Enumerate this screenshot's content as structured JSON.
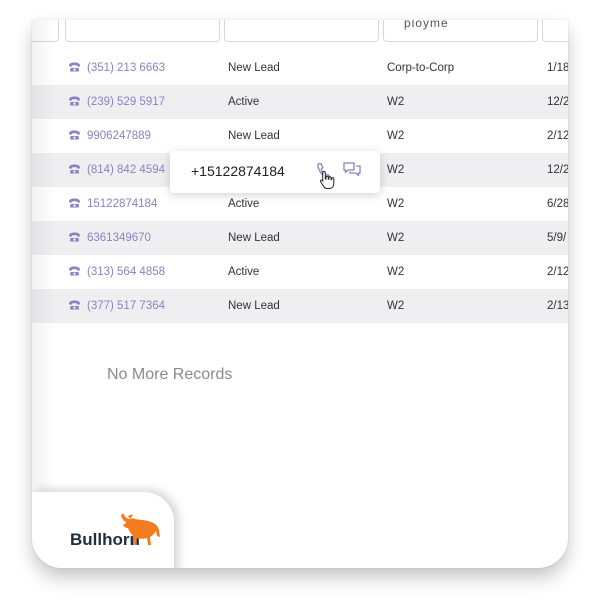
{
  "header": {
    "columns": [
      "",
      "",
      "ployme",
      ""
    ]
  },
  "rows": [
    {
      "phone": "(351) 213 6663",
      "status": "New Lead",
      "type": "Corp-to-Corp",
      "date": "1/18"
    },
    {
      "phone": "(239) 529 5917",
      "status": "Active",
      "type": "W2",
      "date": "12/2"
    },
    {
      "phone": "9906247889",
      "status": "New Lead",
      "type": "W2",
      "date": "2/12"
    },
    {
      "phone": "(814) 842 4594",
      "status": "",
      "type": "W2",
      "date": "12/2"
    },
    {
      "phone": "15122874184",
      "status": "Active",
      "type": "W2",
      "date": "6/28"
    },
    {
      "phone": "6361349670",
      "status": "New Lead",
      "type": "W2",
      "date": "5/9/"
    },
    {
      "phone": "(313) 564 4858",
      "status": "Active",
      "type": "W2",
      "date": "2/12"
    },
    {
      "phone": "(377) 517 7364",
      "status": "New Lead",
      "type": "W2",
      "date": "2/13"
    }
  ],
  "popup": {
    "number": "+15122874184",
    "call_icon": "phone-icon",
    "chat_icon": "chat-icon"
  },
  "footer": {
    "no_more_records": "No More Records"
  },
  "brand": {
    "name": "Bullhorn",
    "accent_color": "#f47b20",
    "text_color": "#1f2d3d"
  },
  "colors": {
    "phone_link": "#8c80c4",
    "row_alt": "#efeff1"
  }
}
